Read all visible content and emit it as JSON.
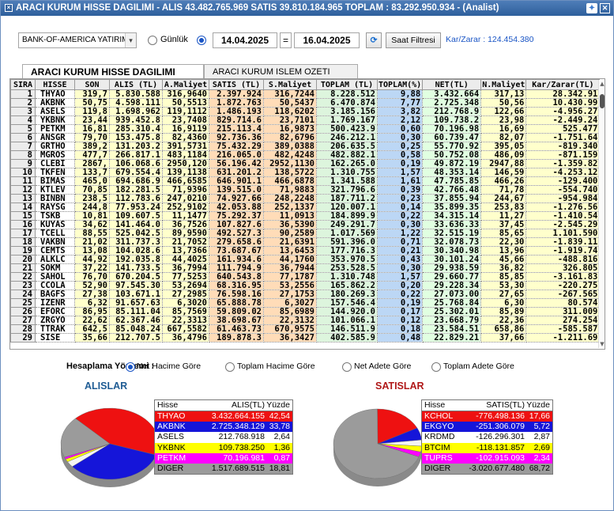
{
  "window": {
    "title": "ARACI KURUM HISSE DAGILIMI - ALIS 43.482.765.969  SATIS 39.810.184.965  TOPLAM : 83.292.950.934 - (Analist)"
  },
  "filters": {
    "broker": "BANK-OF-AMERICA YATIRIM",
    "mode_label": "Günlük",
    "date_start": "14.04.2025",
    "eq": "=",
    "date_end": "16.04.2025",
    "time_filter_label": "Saat Filtresi",
    "profit_loss": "Kar/Zarar : 124.454.380"
  },
  "tabs": [
    {
      "label": "ARACI KURUM HISSE DAGILIMI",
      "active": true
    },
    {
      "label": "ARACI KURUM ISLEM OZETI",
      "active": false
    }
  ],
  "table": {
    "columns": [
      "SIRA",
      "HISSE",
      "SON",
      "ALIS (TL)",
      "A.Maliyet",
      "SATIS (TL)",
      "S.Maliyet",
      "TOPLAM (TL)",
      "TOPLAM(%)",
      "NET(TL)",
      "N.Maliyet",
      "Kar/Zarar(TL)"
    ],
    "rows": [
      [
        "1",
        "THYAO",
        "319,7",
        "5.830.588",
        "316,9640",
        "2.397.924",
        "316,7244",
        "8.228.512",
        "9,88",
        "3.432.664",
        "317,13",
        "28.342.91"
      ],
      [
        "2",
        "AKBNK",
        "50,75",
        "4.598.111",
        "50,5513",
        "1.872.763",
        "50,5437",
        "6.470.874",
        "7,77",
        "2.725.348",
        "50,56",
        "10.430.99"
      ],
      [
        "3",
        "ASELS",
        "119,8",
        "1.698.962",
        "119,1112",
        "1.486.193",
        "118,6202",
        "3.185.156",
        "3,82",
        "212.768.9",
        "122,66",
        "-4.956.27"
      ],
      [
        "4",
        "YKBNK",
        "23,44",
        "939.452.8",
        "23,7408",
        "829.714.6",
        "23,7101",
        "1.769.167",
        "2,12",
        "109.738.2",
        "23,98",
        "-2.449.24"
      ],
      [
        "5",
        "PETKM",
        "16,81",
        "285.310.4",
        "16,9119",
        "215.113.4",
        "16,9873",
        "500.423.9",
        "0,60",
        "70.196.98",
        "16,69",
        "525.477"
      ],
      [
        "6",
        "ANSGR",
        "79,70",
        "153.475.8",
        "82,4360",
        "92.736.36",
        "82,6796",
        "246.212.1",
        "0,30",
        "60.739.47",
        "82,07",
        "-1.751.64"
      ],
      [
        "7",
        "GRTHO",
        "389,2",
        "131.203.2",
        "391,5731",
        "75.432.29",
        "389,0388",
        "206.635.5",
        "0,25",
        "55.770.92",
        "395,05",
        "-819.340"
      ],
      [
        "8",
        "MGROS",
        "477,7",
        "266.817.1",
        "483,1184",
        "216.065.0",
        "482,4248",
        "482.882.1",
        "0,58",
        "50.752.08",
        "486,09",
        "-871.159"
      ],
      [
        "9",
        "CLEBI",
        "2867,",
        "106.068.6",
        "2950,120",
        "56.196.42",
        "2952,1130",
        "162.265.0",
        "0,19",
        "49.872.19",
        "2947,88",
        "-1.359.82"
      ],
      [
        "10",
        "TKFEN",
        "133,7",
        "679.554.4",
        "139,1138",
        "631.201.2",
        "138,5722",
        "1.310.755",
        "1,57",
        "48.353.14",
        "146,59",
        "-4.253.12"
      ],
      [
        "11",
        "BIMAS",
        "465,0",
        "694.686.9",
        "466,6585",
        "646.901.1",
        "466,6878",
        "1.341.588",
        "1,61",
        "47.785.85",
        "466,26",
        "-129.400"
      ],
      [
        "12",
        "KTLEV",
        "70,85",
        "182.281.5",
        "71,9396",
        "139.515.0",
        "71,9883",
        "321.796.6",
        "0,39",
        "42.766.48",
        "71,78",
        "-554.740"
      ],
      [
        "13",
        "BINBN",
        "238,5",
        "112.783.6",
        "247,0210",
        "74.927.66",
        "248,2248",
        "187.711.2",
        "0,23",
        "37.855.94",
        "244,67",
        "-954.984"
      ],
      [
        "14",
        "RAYSG",
        "244,8",
        "77.953.24",
        "252,9102",
        "42.053.88",
        "252,1337",
        "120.007.1",
        "0,14",
        "35.899.35",
        "253,83",
        "-1.276.56"
      ],
      [
        "15",
        "TSKB",
        "10,81",
        "109.607.5",
        "11,1477",
        "75.292.37",
        "11,0913",
        "184.899.9",
        "0,22",
        "34.315.14",
        "11,27",
        "-1.410.54"
      ],
      [
        "16",
        "KUYAS",
        "34,62",
        "141.464.0",
        "36,7526",
        "107.827.6",
        "36,5390",
        "249.291.7",
        "0,30",
        "33.636.33",
        "37,45",
        "-2.545.29"
      ],
      [
        "17",
        "TCELL",
        "88,55",
        "525.042.5",
        "89,9590",
        "492.527.3",
        "90,2589",
        "1.017.569",
        "1,22",
        "32.515.19",
        "85,65",
        "1.101.590"
      ],
      [
        "18",
        "VAKBN",
        "21,02",
        "311.737.3",
        "21,7052",
        "279.658.6",
        "21,6391",
        "591.396.0",
        "0,71",
        "32.078.73",
        "22,30",
        "-1.839.11"
      ],
      [
        "19",
        "CEMTS",
        "13,08",
        "104.028.6",
        "13,7366",
        "73.687.67",
        "13,6453",
        "177.716.3",
        "0,21",
        "30.340.98",
        "13,96",
        "-1.919.74"
      ],
      [
        "20",
        "ALKLC",
        "44,92",
        "192.035.8",
        "44,4025",
        "161.934.6",
        "44,1760",
        "353.970.5",
        "0,43",
        "30.101.24",
        "45,66",
        "-488.816"
      ],
      [
        "21",
        "SOKM",
        "37,22",
        "141.733.5",
        "36,7994",
        "111.794.9",
        "36,7944",
        "253.528.5",
        "0,30",
        "29.938.59",
        "36,82",
        "326.805"
      ],
      [
        "22",
        "SAHOL",
        "76,70",
        "670.204.5",
        "77,5253",
        "640.543.8",
        "77,1787",
        "1.310.748",
        "1,57",
        "29.660.77",
        "85,85",
        "-3.161.83"
      ],
      [
        "23",
        "CCOLA",
        "52,90",
        "97.545.30",
        "53,2694",
        "68.316.95",
        "53,2556",
        "165.862.2",
        "0,20",
        "29.228.34",
        "53,30",
        "-220.275"
      ],
      [
        "24",
        "BAGFS",
        "27,38",
        "103.671.1",
        "27,2985",
        "76.598.16",
        "27,1753",
        "180.269.3",
        "0,22",
        "27.073.00",
        "27,65",
        "-267.565"
      ],
      [
        "25",
        "IZENR",
        "6,32",
        "91.657.63",
        "6,3020",
        "65.888.78",
        "6,3027",
        "157.546.4",
        "0,19",
        "25.768.84",
        "6,30",
        "80.574"
      ],
      [
        "26",
        "EFORC",
        "86,95",
        "85.111.04",
        "85,7569",
        "59.809.02",
        "85,6989",
        "144.920.0",
        "0,17",
        "25.302.01",
        "85,89",
        "311.009"
      ],
      [
        "27",
        "ZRGYO",
        "22,62",
        "62.367.46",
        "22,3313",
        "38.698.67",
        "22,3132",
        "101.066.1",
        "0,12",
        "23.668.79",
        "22,36",
        "274.254"
      ],
      [
        "28",
        "TTRAK",
        "642,5",
        "85.048.24",
        "667,5582",
        "61.463.73",
        "670,9575",
        "146.511.9",
        "0,18",
        "23.584.51",
        "658,86",
        "-585.587"
      ],
      [
        "29",
        "SISE",
        "35,66",
        "212.707.5",
        "36,4796",
        "189.878.3",
        "36,3427",
        "402.585.9",
        "0,48",
        "22.829.21",
        "37,66",
        "-1.211.69"
      ]
    ]
  },
  "method": {
    "label": "Hesaplama Yöntemi :",
    "options": [
      "Net Hacime Göre",
      "Toplam Hacime Göre",
      "Net Adete Göre",
      "Toplam Adete Göre"
    ],
    "selected": 0
  },
  "alislar": {
    "title": "ALISLAR",
    "headers": [
      "Hisse",
      "ALIS(TL)",
      "Yüzde"
    ],
    "rows": [
      {
        "name": "THYAO",
        "value": "3.432.664.155",
        "pct": "42,54",
        "color": "#ee1111",
        "text": "#ffffff"
      },
      {
        "name": "AKBNK",
        "value": "2.725.348.129",
        "pct": "33,78",
        "color": "#1515d9",
        "text": "#ffffff"
      },
      {
        "name": "ASELS",
        "value": "212.768.918",
        "pct": "2,64",
        "color": "#ffffff",
        "text": "#000000"
      },
      {
        "name": "YKBNK",
        "value": "109.738.250",
        "pct": "1,36",
        "color": "#ffff00",
        "text": "#000000"
      },
      {
        "name": "PETKM",
        "value": "70.196.981",
        "pct": "0,87",
        "color": "#ff00ff",
        "text": "#ffffff"
      },
      {
        "name": "DIGER",
        "value": "1.517.689.515",
        "pct": "18,81",
        "color": "#9b9b9b",
        "text": "#000000"
      }
    ]
  },
  "satislar": {
    "title": "SATISLAR",
    "headers": [
      "Hisse",
      "SATIS(TL)",
      "Yüzde"
    ],
    "rows": [
      {
        "name": "KCHOL",
        "value": "-776.498.136",
        "pct": "17,66",
        "color": "#ee1111",
        "text": "#ffffff"
      },
      {
        "name": "EKGYO",
        "value": "-251.306.079",
        "pct": "5,72",
        "color": "#1515d9",
        "text": "#ffffff"
      },
      {
        "name": "KRDMD",
        "value": "-126.296.301",
        "pct": "2,87",
        "color": "#ffffff",
        "text": "#000000"
      },
      {
        "name": "BTCIM",
        "value": "-118.131.857",
        "pct": "2,69",
        "color": "#ffff00",
        "text": "#000000"
      },
      {
        "name": "TUPRS",
        "value": "-102.915.093",
        "pct": "2,34",
        "color": "#ff00ff",
        "text": "#ffffff"
      },
      {
        "name": "DIGER",
        "value": "-3.020.677.480",
        "pct": "68,72",
        "color": "#9b9b9b",
        "text": "#000000"
      }
    ]
  }
}
